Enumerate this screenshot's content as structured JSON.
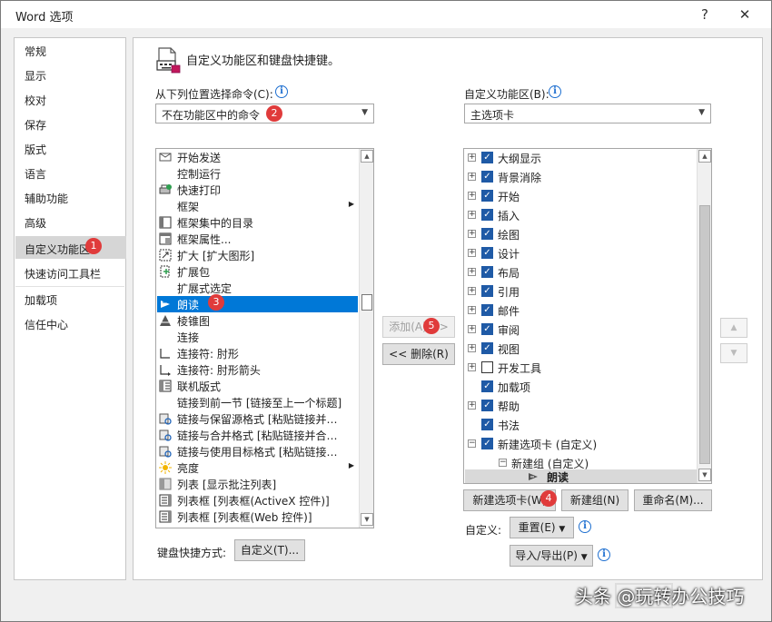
{
  "window": {
    "title": "Word 选项",
    "help_label": "?",
    "close_label": "✕"
  },
  "nav": {
    "items": [
      {
        "label": "常规"
      },
      {
        "label": "显示"
      },
      {
        "label": "校对"
      },
      {
        "label": "保存"
      },
      {
        "label": "版式"
      },
      {
        "label": "语言"
      },
      {
        "label": "辅助功能"
      },
      {
        "label": "高级"
      },
      {
        "label": "自定义功能区",
        "selected": true,
        "badge": "1"
      },
      {
        "label": "快速访问工具栏"
      },
      {
        "label": "加载项"
      },
      {
        "label": "信任中心"
      }
    ]
  },
  "header": {
    "title": "自定义功能区和键盘快捷键。",
    "icon": "customize-ribbon-icon"
  },
  "left": {
    "label": "从下列位置选择命令(C):",
    "dropdown_value": "不在功能区中的命令",
    "dropdown_badge": "2",
    "commands": [
      {
        "label": "开始发送",
        "icon": "send-icon"
      },
      {
        "label": "控制运行",
        "icon": ""
      },
      {
        "label": "快速打印",
        "icon": "quick-print-icon"
      },
      {
        "label": "框架",
        "icon": "",
        "submenu": true
      },
      {
        "label": "框架集中的目录",
        "icon": "frames-toc-icon"
      },
      {
        "label": "框架属性...",
        "icon": "frame-properties-icon"
      },
      {
        "label": "扩大 [扩大图形]",
        "icon": "enlarge-icon"
      },
      {
        "label": "扩展包",
        "icon": "expansion-pack-icon"
      },
      {
        "label": "扩展式选定",
        "icon": ""
      },
      {
        "label": "朗读",
        "icon": "read-aloud-icon",
        "selected": true,
        "badge": "3"
      },
      {
        "label": "棱锥图",
        "icon": "pyramid-icon"
      },
      {
        "label": "连接",
        "icon": ""
      },
      {
        "label": "连接符: 肘形",
        "icon": "elbow-connector-icon"
      },
      {
        "label": "连接符: 肘形箭头",
        "icon": "elbow-arrow-connector-icon"
      },
      {
        "label": "联机版式",
        "icon": "online-layout-icon"
      },
      {
        "label": "链接到前一节 [链接至上一个标题]",
        "icon": ""
      },
      {
        "label": "链接与保留源格式 [粘贴链接并…",
        "icon": "link-keep-source-icon"
      },
      {
        "label": "链接与合并格式 [粘贴链接并合…",
        "icon": "link-merge-icon"
      },
      {
        "label": "链接与使用目标格式 [粘贴链接…",
        "icon": "link-dest-icon"
      },
      {
        "label": "亮度",
        "icon": "brightness-icon",
        "submenu": true
      },
      {
        "label": "列表 [显示批注列表]",
        "icon": "list-icon"
      },
      {
        "label": "列表框 [列表框(ActiveX 控件)]",
        "icon": "listbox-activex-icon"
      },
      {
        "label": "列表框 [列表框(Web 控件)]",
        "icon": "listbox-web-icon"
      }
    ],
    "shortcut_label": "键盘快捷方式:",
    "shortcut_button": "自定义(T)..."
  },
  "middle": {
    "add_button": "添加(A) >>",
    "add_badge": "5",
    "remove_button": "<< 删除(R)"
  },
  "right": {
    "label": "自定义功能区(B):",
    "dropdown_value": "主选项卡",
    "tree": [
      {
        "label": "大纲显示",
        "checked": true,
        "expander": "+"
      },
      {
        "label": "背景消除",
        "checked": true,
        "expander": "+"
      },
      {
        "label": "开始",
        "checked": true,
        "expander": "+"
      },
      {
        "label": "插入",
        "checked": true,
        "expander": "+"
      },
      {
        "label": "绘图",
        "checked": true,
        "expander": "+"
      },
      {
        "label": "设计",
        "checked": true,
        "expander": "+"
      },
      {
        "label": "布局",
        "checked": true,
        "expander": "+"
      },
      {
        "label": "引用",
        "checked": true,
        "expander": "+"
      },
      {
        "label": "邮件",
        "checked": true,
        "expander": "+"
      },
      {
        "label": "审阅",
        "checked": true,
        "expander": "+"
      },
      {
        "label": "视图",
        "checked": true,
        "expander": "+"
      },
      {
        "label": "开发工具",
        "checked": false,
        "expander": "+"
      },
      {
        "label": "加载项",
        "checked": true,
        "expander": ""
      },
      {
        "label": "帮助",
        "checked": true,
        "expander": "+"
      },
      {
        "label": "书法",
        "checked": true,
        "expander": ""
      },
      {
        "label": "新建选项卡 (自定义)",
        "checked": true,
        "expander": "−"
      }
    ],
    "new_group": "新建组 (自定义)",
    "new_item": "朗读",
    "new_tab_button": "新建选项卡(W)",
    "new_tab_badge": "4",
    "new_group_button": "新建组(N)",
    "rename_button": "重命名(M)...",
    "customize_label": "自定义:",
    "reset_button": "重置(E)",
    "import_export_button": "导入/导出(P)"
  },
  "watermark": "头条 @玩转办公技巧"
}
